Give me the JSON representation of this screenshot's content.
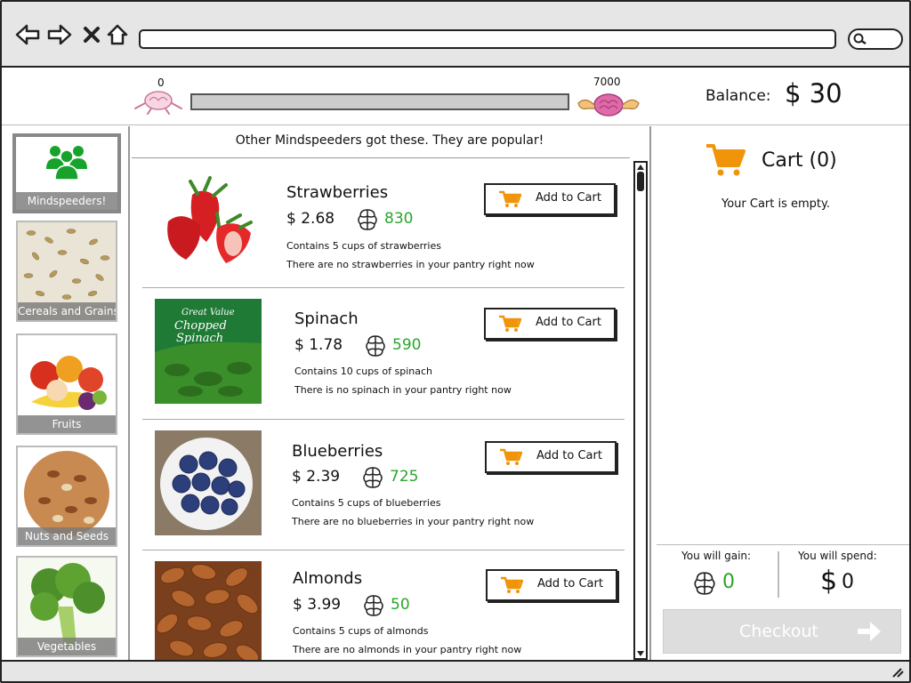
{
  "header": {
    "progress_min": "0",
    "progress_max": "7000",
    "progress_fraction": 0.0,
    "balance_label": "Balance:",
    "balance_value": "$ 30"
  },
  "sidebar": {
    "items": [
      {
        "label": "Mindspeeders!",
        "icon": "group-icon",
        "active": true
      },
      {
        "label": "Cereals and Grains",
        "icon": "grains-icon"
      },
      {
        "label": "Fruits",
        "icon": "fruits-icon"
      },
      {
        "label": "Nuts and Seeds",
        "icon": "nuts-icon"
      },
      {
        "label": "Vegetables",
        "icon": "broccoli-icon"
      }
    ]
  },
  "main": {
    "popular_text": "Other Mindspeeders got these. They are popular!",
    "add_label": "Add to Cart",
    "products": [
      {
        "name": "Strawberries",
        "price": "$ 2.68",
        "points": "830",
        "desc": "Contains 5 cups of strawberries",
        "pantry": "There are no strawberries in your pantry right now"
      },
      {
        "name": "Spinach",
        "price": "$ 1.78",
        "points": "590",
        "desc": "Contains 10 cups of spinach",
        "pantry": "There is no spinach in your pantry right now"
      },
      {
        "name": "Blueberries",
        "price": "$ 2.39",
        "points": "725",
        "desc": "Contains 5 cups of blueberries",
        "pantry": "There are no blueberries in your pantry right now"
      },
      {
        "name": "Almonds",
        "price": "$ 3.99",
        "points": "50",
        "desc": "Contains 5 cups of almonds",
        "pantry": "There are no almonds in your pantry right now"
      }
    ]
  },
  "cart": {
    "title": "Cart (0)",
    "empty_text": "Your Cart is empty.",
    "gain_label": "You will gain:",
    "gain_value": "0",
    "spend_label": "You will spend:",
    "spend_symbol": "$",
    "spend_value": "0",
    "checkout_label": "Checkout"
  },
  "colors": {
    "accent_orange": "#f0940a",
    "points_green": "#2aa52a",
    "mindspeeders_green": "#17a32b"
  }
}
